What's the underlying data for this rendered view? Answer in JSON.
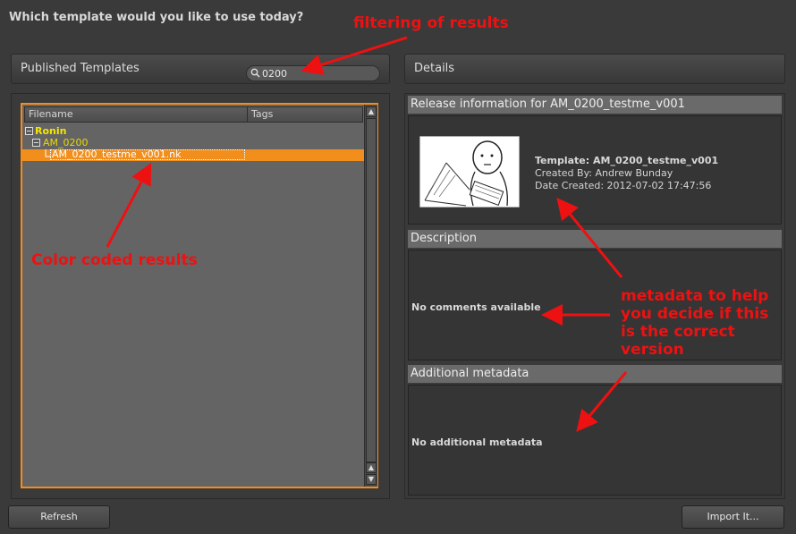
{
  "heading": "Which template would you like to use today?",
  "left_panel": {
    "title": "Published Templates",
    "search": {
      "value": "0200"
    },
    "columns": [
      "Filename",
      "Tags"
    ],
    "tree": {
      "root": "Ronin",
      "child": "AM_0200",
      "leaf": "AM_0200_testme_v001.nk"
    }
  },
  "right_panel": {
    "title": "Details",
    "release": {
      "header": "Release information for AM_0200_testme_v001",
      "template": "Template: AM_0200_testme_v001",
      "created_by": "Created By: Andrew Bunday",
      "date_created": "Date Created: 2012-07-02 17:47:56"
    },
    "description": {
      "header": "Description",
      "text": "No comments available"
    },
    "additional": {
      "header": "Additional metadata",
      "text": "No additional metadata"
    }
  },
  "buttons": {
    "refresh": "Refresh",
    "import": "Import It..."
  },
  "annotations": {
    "filtering": "filtering of results",
    "color_coded": "Color coded results",
    "metadata": [
      "metadata to help",
      "you decide if this",
      "is the correct",
      "version"
    ]
  },
  "colors": {
    "accent": "#f28e1c",
    "root_text": "#f5e600",
    "child_text": "#e8d900",
    "annotation": "#ee1111"
  }
}
